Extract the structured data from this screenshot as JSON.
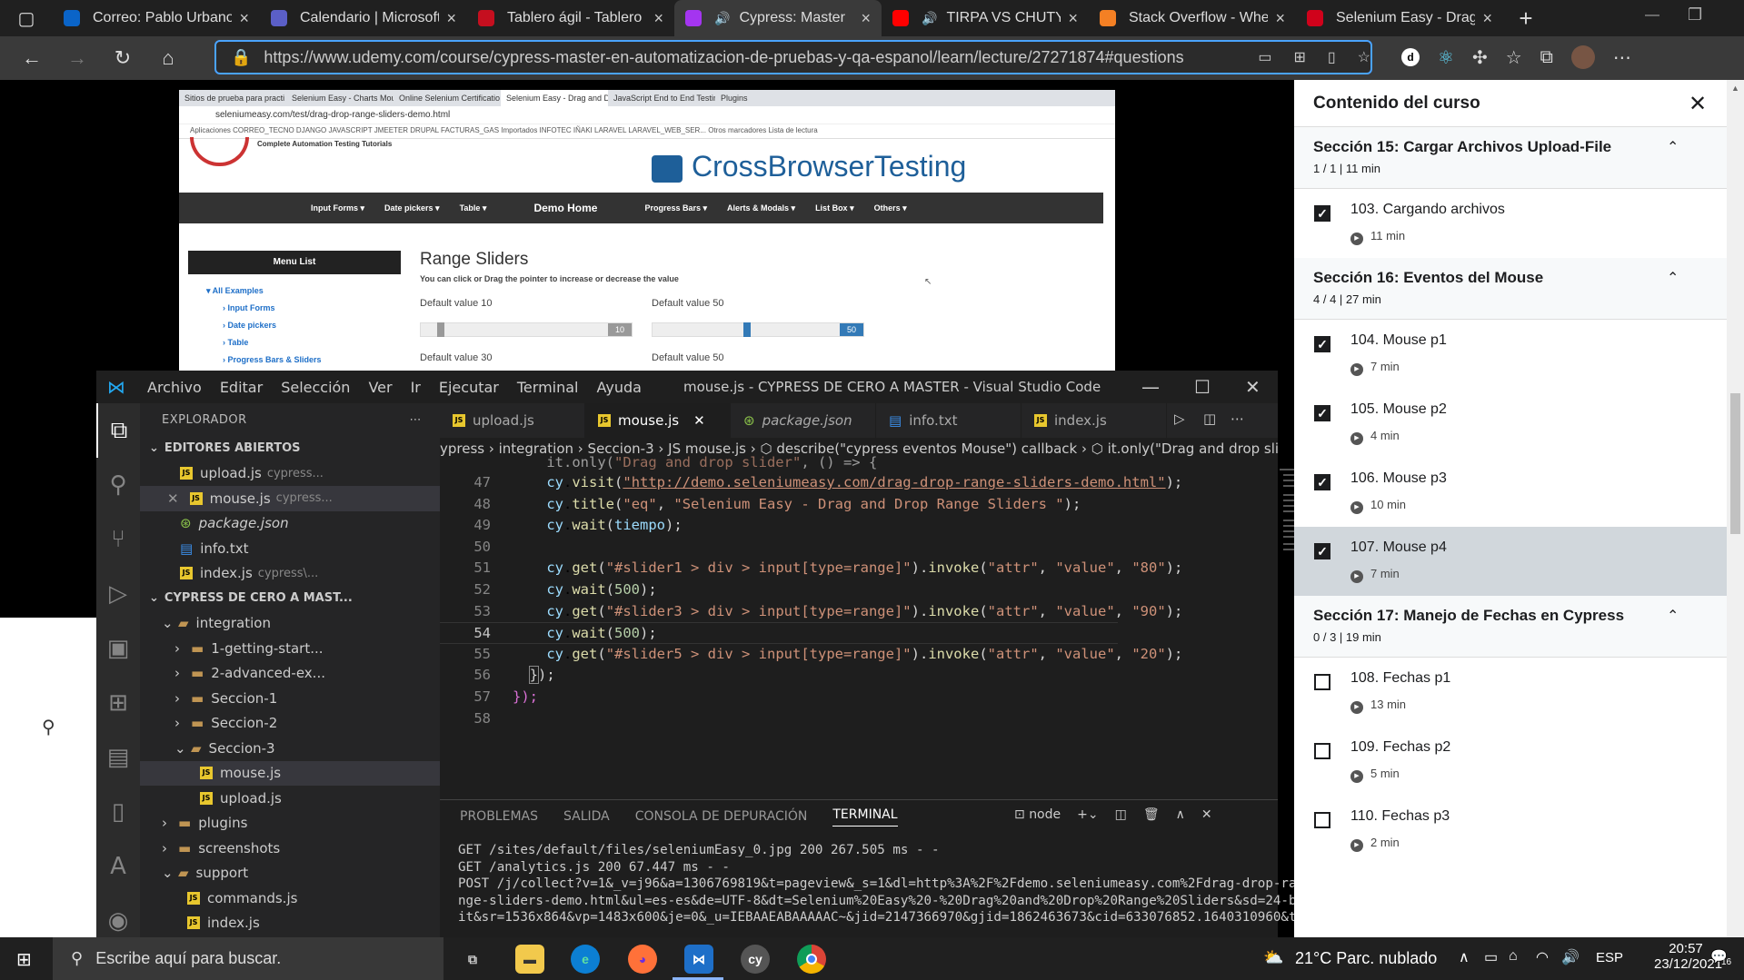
{
  "browser": {
    "tabs": [
      {
        "label": "Correo: Pablo Urbano",
        "icon": "outlook-icon",
        "color": "#0a64c8"
      },
      {
        "label": "Calendario | Microsoft",
        "icon": "teams-icon",
        "color": "#5b5fc7"
      },
      {
        "label": "Tablero ágil - Tablero",
        "icon": "azure-devops-icon",
        "color": "#c50f1f"
      },
      {
        "label": "Cypress: Master",
        "icon": "udemy-icon",
        "color": "#a435f0",
        "active": true,
        "audio": true
      },
      {
        "label": "TIRPA VS CHUTY",
        "icon": "youtube-icon",
        "color": "#ff0000",
        "audio": true
      },
      {
        "label": "Stack Overflow - Whe",
        "icon": "stackoverflow-icon",
        "color": "#f48024"
      },
      {
        "label": "Selenium Easy - Drag",
        "icon": "selenium-easy-icon",
        "color": "#d0021b"
      }
    ],
    "url": "https://www.udemy.com/course/cypress-master-en-automatizacion-de-pruebas-y-qa-espanol/learn/lecture/27271874#questions",
    "url_host": "www.udemy.com"
  },
  "inner_chrome": {
    "tabs": [
      "Sitios de prueba para practi",
      "Selenium Easy - Charts Mou",
      "Online Selenium Certificatio",
      "Selenium Easy - Drag and D",
      "JavaScript End to End Testin",
      "Plugins"
    ],
    "url": "seleniumeasy.com/test/drag-drop-range-sliders-demo.html",
    "bookmarks": "Aplicaciones   CORREO_TECNO   DJANGO   JAVASCRIPT   JMEETER   DRUPAL   FACTURAS_GAS   Importados   INFOTEC   IÑAKI   LARAVEL   LARAVEL_WEB_SER...   Otros marcadores   Lista de lectura",
    "brand": "CrossBrowserTesting",
    "tagline": "Complete Automation Testing Tutorials",
    "nav": [
      "Input Forms ▾",
      "Date pickers ▾",
      "Table ▾",
      "Demo Home",
      "Progress Bars ▾",
      "Alerts & Modals ▾",
      "List Box ▾",
      "Others ▾"
    ],
    "menu_title": "Menu List",
    "tree": [
      "▾ All Examples",
      "› Input Forms",
      "› Date pickers",
      "› Table",
      "› Progress Bars & Sliders"
    ],
    "page_title": "Range Sliders",
    "page_sub": "You can click or Drag the pointer to increase or decrease the value",
    "sliders": [
      {
        "label": "Default value 10",
        "value": "10",
        "color": "#999999"
      },
      {
        "label": "Default value 50",
        "value": "50",
        "color": "#337ab7"
      },
      {
        "label": "Default value 30"
      },
      {
        "label": "Default value 50"
      }
    ]
  },
  "vscode": {
    "menu": [
      "Archivo",
      "Editar",
      "Selección",
      "Ver",
      "Ir",
      "Ejecutar",
      "Terminal",
      "Ayuda"
    ],
    "title": "mouse.js - CYPRESS DE CERO A MASTER - Visual Studio Code",
    "explorer": "EXPLORADOR",
    "open_editors": "EDITORES ABIERTOS",
    "open_files": [
      {
        "name": "upload.js",
        "path": "cypress...",
        "type": "js"
      },
      {
        "name": "mouse.js",
        "path": "cypress...",
        "type": "js",
        "selected": true
      },
      {
        "name": "package.json",
        "path": "",
        "type": "json"
      },
      {
        "name": "info.txt",
        "path": "",
        "type": "txt"
      },
      {
        "name": "index.js",
        "path": "cypress\\...",
        "type": "js"
      }
    ],
    "project": "CYPRESS DE CERO A MAST...",
    "tree": [
      {
        "label": "integration",
        "indent": 1,
        "kind": "open"
      },
      {
        "label": "1-getting-start...",
        "indent": 2,
        "kind": "closed"
      },
      {
        "label": "2-advanced-ex...",
        "indent": 2,
        "kind": "closed"
      },
      {
        "label": "Seccion-1",
        "indent": 2,
        "kind": "closed"
      },
      {
        "label": "Seccion-2",
        "indent": 2,
        "kind": "closed"
      },
      {
        "label": "Seccion-3",
        "indent": 2,
        "kind": "open"
      },
      {
        "label": "mouse.js",
        "indent": 3,
        "kind": "js"
      },
      {
        "label": "upload.js",
        "indent": 3,
        "kind": "js"
      },
      {
        "label": "plugins",
        "indent": 1,
        "kind": "closed"
      },
      {
        "label": "screenshots",
        "indent": 1,
        "kind": "closed"
      },
      {
        "label": "support",
        "indent": 1,
        "kind": "open"
      },
      {
        "label": "commands.js",
        "indent": 2,
        "kind": "js"
      },
      {
        "label": "index.js",
        "indent": 2,
        "kind": "js"
      }
    ],
    "tabs": [
      {
        "label": "upload.js",
        "type": "js"
      },
      {
        "label": "mouse.js",
        "type": "js",
        "active": true
      },
      {
        "label": "package.json",
        "type": "json"
      },
      {
        "label": "info.txt",
        "type": "txt"
      },
      {
        "label": "index.js",
        "type": "js"
      }
    ],
    "breadcrumb": "ypress  ›  integration  ›  Seccion-3  ›  JS mouse.js  ›  ⬡ describe(\"cypress eventos Mouse\") callback  ›  ⬡ it.only(\"Drag and drop slider\") callback",
    "current_line": "54",
    "panel_tabs": [
      "PROBLEMAS",
      "SALIDA",
      "CONSOLA DE DEPURACIÓN",
      "TERMINAL"
    ],
    "terminal_name": "node",
    "terminal_lines": [
      "GET /sites/default/files/seleniumEasy_0.jpg 200 267.505 ms - -",
      "GET /analytics.js 200 67.447 ms - -",
      "POST /j/collect?v=1&_v=j96&a=1306769819&t=pageview&_s=1&dl=http%3A%2F%2Fdemo.seleniumeasy.com%2Fdrag-drop-ra",
      "nge-sliders-demo.html&ul=es-es&de=UTF-8&dt=Selenium%20Easy%20-%20Drag%20and%20Drop%20Range%20Sliders&sd=24-b",
      "it&sr=1536x864&vp=1483x600&je=0&_u=IEBAAEABAAAAAC~&jid=2147366970&gjid=1862463673&cid=633076852.1640310960&t"
    ]
  },
  "udemy": {
    "header": "Contenido del curso",
    "sections": [
      {
        "title": "Sección 15: Cargar Archivos Upload-File",
        "meta": "1 / 1 | 11 min",
        "lectures": [
          {
            "title": "103. Cargando archivos",
            "dur": "11 min",
            "done": true
          }
        ]
      },
      {
        "title": "Sección 16: Eventos del Mouse",
        "meta": "4 / 4 | 27 min",
        "lectures": [
          {
            "title": "104. Mouse p1",
            "dur": "7 min",
            "done": true
          },
          {
            "title": "105. Mouse p2",
            "dur": "4 min",
            "done": true
          },
          {
            "title": "106. Mouse p3",
            "dur": "10 min",
            "done": true
          },
          {
            "title": "107. Mouse p4",
            "dur": "7 min",
            "done": true,
            "current": true
          }
        ]
      },
      {
        "title": "Sección 17: Manejo de Fechas en Cypress",
        "meta": "0 / 3 | 19 min",
        "lectures": [
          {
            "title": "108. Fechas p1",
            "dur": "13 min",
            "done": false
          },
          {
            "title": "109. Fechas p2",
            "dur": "5 min",
            "done": false
          },
          {
            "title": "110. Fechas p3",
            "dur": "2 min",
            "done": false
          }
        ]
      }
    ]
  },
  "taskbar": {
    "search_placeholder": "Escribe aquí para buscar.",
    "apps": [
      "task-view-icon",
      "file-explorer-icon",
      "edge-icon",
      "firefox-icon",
      "vscode-icon",
      "cypress-icon",
      "chrome-icon"
    ],
    "weather": "21°C  Parc. nublado",
    "lang": "ESP",
    "time": "20:57",
    "date": "23/12/2021",
    "notifications": "16"
  }
}
